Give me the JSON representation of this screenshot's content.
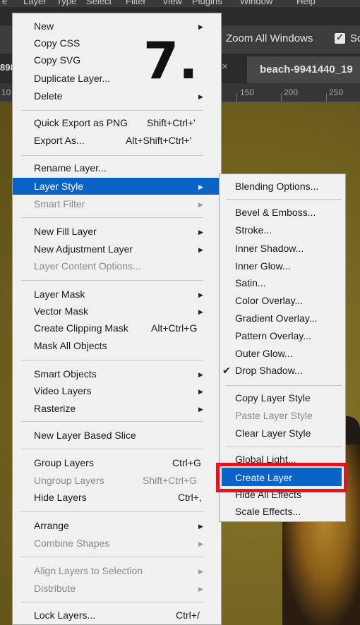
{
  "menubar": {
    "items": [
      "e",
      "Layer",
      "Type",
      "Select",
      "Filter",
      "View",
      "Plugins",
      "Window",
      "Help"
    ]
  },
  "options": {
    "zoom_all": "Zoom All Windows",
    "trailing": "Sc"
  },
  "tabs": {
    "left_fragment": "898",
    "close": "×",
    "active": "beach-9941440_19"
  },
  "ruler": {
    "labels": [
      "10",
      "150",
      "200",
      "250"
    ]
  },
  "step_number": "7.",
  "menu": {
    "items": [
      {
        "label": "New",
        "submenu": true,
        "enabled": true
      },
      {
        "label": "Copy CSS",
        "enabled": true
      },
      {
        "label": "Copy SVG",
        "enabled": true
      },
      {
        "label": "Duplicate Layer...",
        "enabled": true
      },
      {
        "label": "Delete",
        "submenu": true,
        "enabled": true
      },
      {
        "label": "Quick Export as PNG",
        "shortcut": "Shift+Ctrl+'",
        "enabled": true
      },
      {
        "label": "Export As...",
        "shortcut": "Alt+Shift+Ctrl+'",
        "enabled": true
      },
      {
        "label": "Rename Layer...",
        "enabled": true
      },
      {
        "label": "Layer Style",
        "submenu": true,
        "enabled": true,
        "highlighted": true
      },
      {
        "label": "Smart Filter",
        "submenu": true,
        "enabled": false
      },
      {
        "label": "New Fill Layer",
        "submenu": true,
        "enabled": true
      },
      {
        "label": "New Adjustment Layer",
        "submenu": true,
        "enabled": true
      },
      {
        "label": "Layer Content Options...",
        "enabled": false
      },
      {
        "label": "Layer Mask",
        "submenu": true,
        "enabled": true
      },
      {
        "label": "Vector Mask",
        "submenu": true,
        "enabled": true
      },
      {
        "label": "Create Clipping Mask",
        "shortcut": "Alt+Ctrl+G",
        "enabled": true
      },
      {
        "label": "Mask All Objects",
        "enabled": true
      },
      {
        "label": "Smart Objects",
        "submenu": true,
        "enabled": true
      },
      {
        "label": "Video Layers",
        "submenu": true,
        "enabled": true
      },
      {
        "label": "Rasterize",
        "submenu": true,
        "enabled": true
      },
      {
        "label": "New Layer Based Slice",
        "enabled": true
      },
      {
        "label": "Group Layers",
        "shortcut": "Ctrl+G",
        "enabled": true
      },
      {
        "label": "Ungroup Layers",
        "shortcut": "Shift+Ctrl+G",
        "enabled": false
      },
      {
        "label": "Hide Layers",
        "shortcut": "Ctrl+,",
        "enabled": true
      },
      {
        "label": "Arrange",
        "submenu": true,
        "enabled": true
      },
      {
        "label": "Combine Shapes",
        "submenu": true,
        "enabled": false
      },
      {
        "label": "Align Layers to Selection",
        "submenu": true,
        "enabled": false
      },
      {
        "label": "Distribute",
        "submenu": true,
        "enabled": false
      },
      {
        "label": "Lock Layers...",
        "shortcut": "Ctrl+/",
        "enabled": true
      }
    ]
  },
  "submenu": {
    "items": [
      {
        "label": "Blending Options...",
        "enabled": true
      },
      {
        "label": "Bevel & Emboss...",
        "enabled": true
      },
      {
        "label": "Stroke...",
        "enabled": true
      },
      {
        "label": "Inner Shadow...",
        "enabled": true
      },
      {
        "label": "Inner Glow...",
        "enabled": true
      },
      {
        "label": "Satin...",
        "enabled": true
      },
      {
        "label": "Color Overlay...",
        "enabled": true
      },
      {
        "label": "Gradient Overlay...",
        "enabled": true
      },
      {
        "label": "Pattern Overlay...",
        "enabled": true
      },
      {
        "label": "Outer Glow...",
        "enabled": true
      },
      {
        "label": "Drop Shadow...",
        "enabled": true,
        "checked": true
      },
      {
        "label": "Copy Layer Style",
        "enabled": true
      },
      {
        "label": "Paste Layer Style",
        "enabled": false
      },
      {
        "label": "Clear Layer Style",
        "enabled": true
      },
      {
        "label": "Global Light...",
        "enabled": true
      },
      {
        "label": "Create Layer",
        "enabled": true,
        "highlighted": true
      },
      {
        "label": "Hide All Effects",
        "enabled": true
      },
      {
        "label": "Scale Effects...",
        "enabled": true
      }
    ]
  },
  "colors": {
    "highlight": "#0a64c8",
    "callout_box": "#e0151f"
  }
}
